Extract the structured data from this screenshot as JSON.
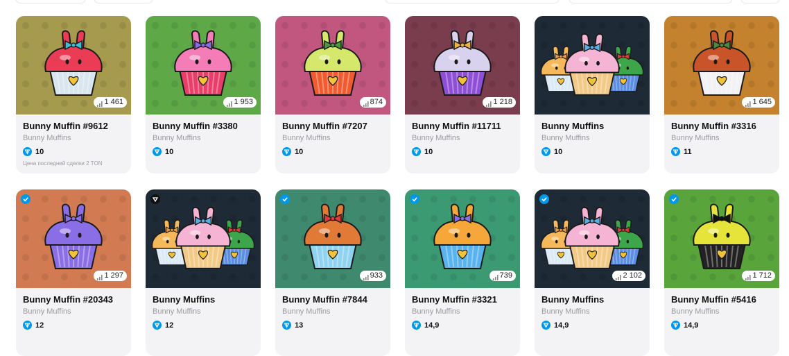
{
  "colors": {
    "ton_blue": "#0098ea",
    "card_bg": "#f3f3f5",
    "muted_text": "#9a9aa2"
  },
  "cards": [
    {
      "title": "Bunny Muffin #9612",
      "collection": "Bunny Muffins",
      "price": "10",
      "stat": "1 461",
      "note": "Цена последней сделки 2 TON",
      "bg": "#a59a4e",
      "corner": "",
      "frosting": "#ea3c55",
      "cup": "#d9e6ef",
      "bow": "#3cc0d8",
      "kind": "single"
    },
    {
      "title": "Bunny Muffin #3380",
      "collection": "Bunny Muffins",
      "price": "10",
      "stat": "1 953",
      "note": "",
      "bg": "#5ea847",
      "corner": "",
      "frosting": "#f47cb7",
      "cup": "#e83e6a",
      "bow": "#8a6ee6",
      "kind": "single"
    },
    {
      "title": "Bunny Muffin #7207",
      "collection": "Bunny Muffins",
      "price": "10",
      "stat": "874",
      "note": "",
      "bg": "#c1577e",
      "corner": "",
      "frosting": "#d5e86b",
      "cup": "#ef5a2e",
      "bow": "#4a9a3e",
      "kind": "single"
    },
    {
      "title": "Bunny Muffin #11711",
      "collection": "Bunny Muffins",
      "price": "10",
      "stat": "1 218",
      "note": "",
      "bg": "#7a3d4e",
      "corner": "",
      "frosting": "#d8d2ee",
      "cup": "#8e4fd6",
      "bow": "#f0b23a",
      "kind": "single"
    },
    {
      "title": "Bunny Muffins",
      "collection": "Bunny Muffins",
      "price": "10",
      "stat": "",
      "note": "",
      "bg": "#1e2a36",
      "corner": "",
      "frosting": "#f6b4d4",
      "cup": "#f2c986",
      "bow": "#5aaee6",
      "kind": "trio"
    },
    {
      "title": "Bunny Muffin #3316",
      "collection": "Bunny Muffins",
      "price": "11",
      "stat": "1 645",
      "note": "",
      "bg": "#c4822e",
      "corner": "",
      "frosting": "#c9542a",
      "cup": "#f2f2f4",
      "bow": "#4b8a3a",
      "kind": "single"
    },
    {
      "title": "Bunny Muffin #20343",
      "collection": "Bunny Muffins",
      "price": "12",
      "stat": "1 297",
      "note": "",
      "bg": "#d27b52",
      "corner": "check",
      "frosting": "#8a6ee6",
      "cup": "#8a6ee6",
      "bow": "#8a6ee6",
      "kind": "single"
    },
    {
      "title": "Bunny Muffins",
      "collection": "Bunny Muffins",
      "price": "12",
      "stat": "",
      "note": "",
      "bg": "#1e2a36",
      "corner": "gem",
      "frosting": "#f6b4d4",
      "cup": "#f2c986",
      "bow": "#5aaee6",
      "kind": "trio"
    },
    {
      "title": "Bunny Muffin #7844",
      "collection": "Bunny Muffins",
      "price": "13",
      "stat": "933",
      "note": "",
      "bg": "#3f8a6e",
      "corner": "check",
      "frosting": "#e07a36",
      "cup": "#8fd3f0",
      "bow": "#e03a3a",
      "kind": "single"
    },
    {
      "title": "Bunny Muffin #3321",
      "collection": "Bunny Muffins",
      "price": "14,9",
      "stat": "739",
      "note": "",
      "bg": "#3c9a73",
      "corner": "check",
      "frosting": "#f5a73a",
      "cup": "#59b3ee",
      "bow": "#8a6ee6",
      "kind": "single"
    },
    {
      "title": "Bunny Muffins",
      "collection": "Bunny Muffins",
      "price": "14,9",
      "stat": "2 102",
      "note": "",
      "bg": "#1e2a36",
      "corner": "check",
      "frosting": "#f6b4d4",
      "cup": "#f2c986",
      "bow": "#5aaee6",
      "kind": "trio"
    },
    {
      "title": "Bunny Muffin #5416",
      "collection": "Bunny Muffins",
      "price": "14,9",
      "stat": "1 712",
      "note": "",
      "bg": "#5aa43c",
      "corner": "check",
      "frosting": "#e6e43a",
      "cup": "#222222",
      "bow": "#111111",
      "kind": "single"
    }
  ]
}
